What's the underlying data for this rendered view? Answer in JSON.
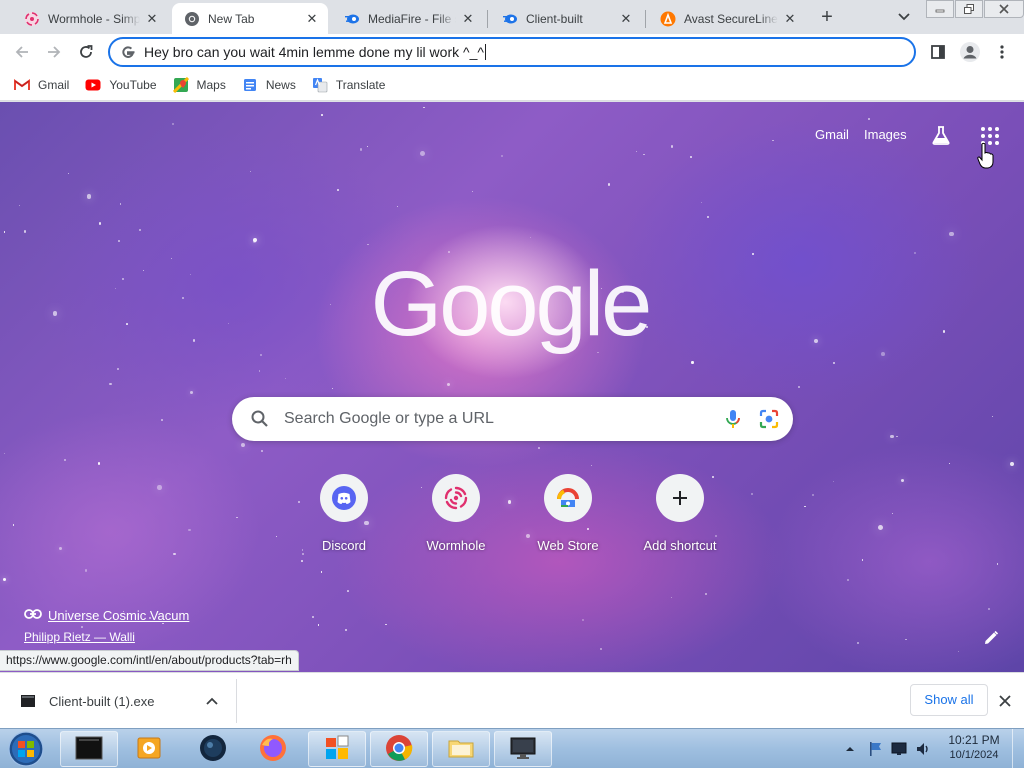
{
  "tabs": [
    {
      "title": "Wormhole - Simple, private file sharing",
      "icon": "wormhole-icon",
      "active": false
    },
    {
      "title": "New Tab",
      "icon": "chrome-icon",
      "active": true
    },
    {
      "title": "MediaFire - File sharing",
      "icon": "mediafire-icon",
      "active": false
    },
    {
      "title": "Client-built",
      "icon": "mediafire-icon",
      "active": false
    },
    {
      "title": "Avast SecureLine VPN",
      "icon": "avast-icon",
      "active": false
    }
  ],
  "omnibox": {
    "text": "Hey bro can you wait 4min lemme done my lil work ^_^"
  },
  "bookmarks": [
    {
      "label": "Gmail",
      "icon": "gmail-icon"
    },
    {
      "label": "YouTube",
      "icon": "youtube-icon"
    },
    {
      "label": "Maps",
      "icon": "maps-icon"
    },
    {
      "label": "News",
      "icon": "news-icon"
    },
    {
      "label": "Translate",
      "icon": "translate-icon"
    }
  ],
  "ntp": {
    "gmail_link": "Gmail",
    "images_link": "Images",
    "search_placeholder": "Search Google or type a URL",
    "shortcuts": [
      {
        "label": "Discord",
        "icon": "discord-icon"
      },
      {
        "label": "Wormhole",
        "icon": "wormhole-icon"
      },
      {
        "label": "Web Store",
        "icon": "web-store-icon"
      },
      {
        "label": "Add shortcut",
        "icon": "plus-icon"
      }
    ],
    "attribution_title": "Universe Cosmic Vacum",
    "attribution_author": "Philipp Rietz — Walli"
  },
  "status_url": "https://www.google.com/intl/en/about/products?tab=rh",
  "downloads": {
    "filename": "Client-built (1).exe",
    "show_all": "Show all"
  },
  "taskbar": {
    "time": "10:21 PM",
    "date": "10/1/2024"
  },
  "colors": {
    "accent": "#1a73e8",
    "taskbar": "#9fbfe0",
    "ntp_background": "#8e5cc6"
  }
}
